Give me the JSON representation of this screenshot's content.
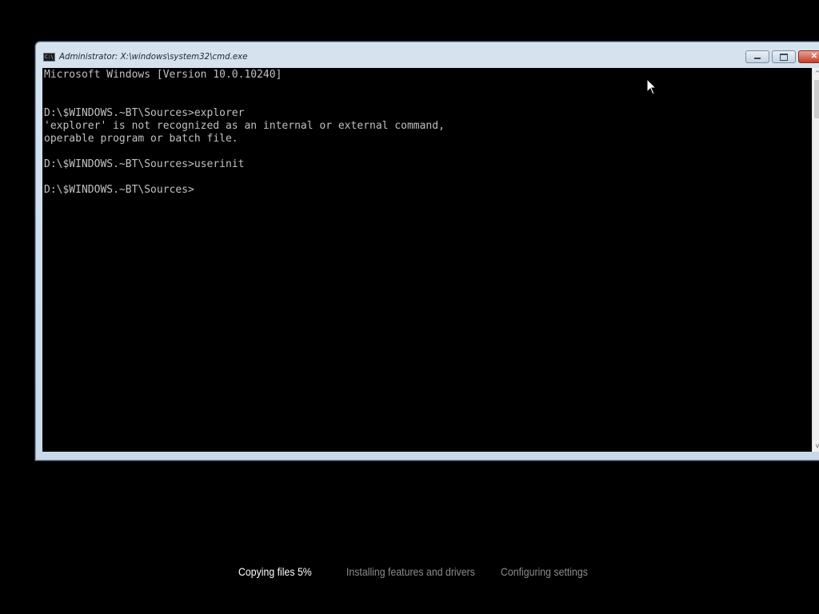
{
  "window": {
    "title": "Administrator: X:\\windows\\system32\\cmd.exe",
    "icon": "cmd-icon",
    "icon_text": "C:\\",
    "buttons": {
      "minimize": "minimize-icon",
      "restore": "restore-icon",
      "close_label": "✕"
    }
  },
  "console": {
    "lines": [
      "Microsoft Windows [Version 10.0.10240]",
      "",
      "",
      "D:\\$WINDOWS.~BT\\Sources>explorer",
      "'explorer' is not recognized as an internal or external command,",
      "operable program or batch file.",
      "",
      "D:\\$WINDOWS.~BT\\Sources>userinit",
      "",
      "D:\\$WINDOWS.~BT\\Sources>"
    ],
    "text_color": "#c0c0c0",
    "background_color": "#000000"
  },
  "scrollbar": {
    "up_arrow": "^",
    "down_arrow": "v"
  },
  "setup": {
    "steps": [
      "Copying files 5%",
      "Installing features and drivers",
      "Configuring settings"
    ],
    "active_color": "#ffffff",
    "inactive_color": "#8c8c8c",
    "progress_percent": 5
  }
}
